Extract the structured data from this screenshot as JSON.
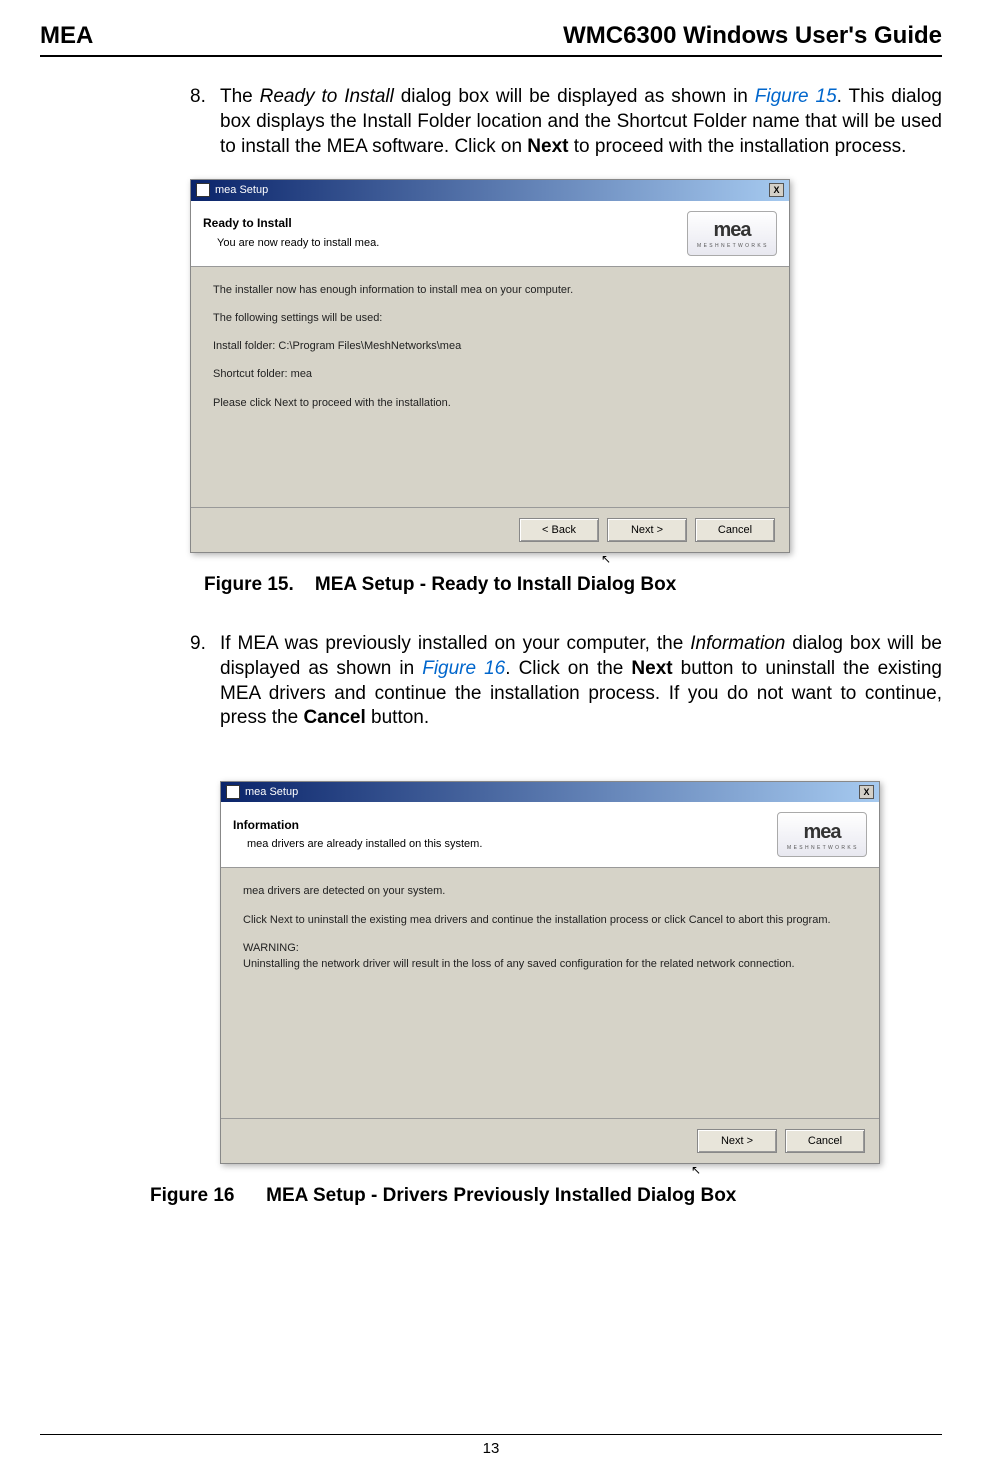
{
  "header": {
    "left": "MEA",
    "right": "WMC6300 Windows User's Guide"
  },
  "item8": {
    "num": "8.",
    "t1": "The ",
    "italic1": "Ready to Install",
    "t2": " dialog box will be displayed as shown in ",
    "figref": "Figure 15",
    "t3": ". This dialog box displays the Install Folder location and the Shortcut Folder name that will be used to install the MEA software.  Click on ",
    "bold1": "Next",
    "t4": " to proceed with the installation process."
  },
  "dialog1": {
    "title": "mea Setup",
    "close": "X",
    "headerTitle": "Ready to Install",
    "headerSub": "You are now ready to install mea.",
    "logo": "mea",
    "logoSub": "M E S H N E T W O R K S",
    "body1": "The installer now has enough information to install mea on your computer.",
    "body2": "The following settings will be used:",
    "body3": "Install folder: C:\\Program Files\\MeshNetworks\\mea",
    "body4": "Shortcut folder: mea",
    "body5": "Please click Next to proceed with the installation.",
    "btnBack": "< Back",
    "btnNext": "Next >",
    "btnCancel": "Cancel"
  },
  "caption1": {
    "num": "Figure 15.",
    "text": "MEA Setup - Ready to Install Dialog Box"
  },
  "item9": {
    "num": "9.",
    "t1": "If MEA was previously installed on your computer, the ",
    "italic1": "Information",
    "t2": " dialog box will be displayed as shown in ",
    "figref": "Figure 16",
    "t3": ".  Click on the ",
    "bold1": "Next",
    "t4": " button to uninstall the existing MEA drivers and continue the installation process.  If you do not want to continue, press the ",
    "bold2": "Cancel",
    "t5": " button."
  },
  "dialog2": {
    "title": "mea Setup",
    "close": "X",
    "headerTitle": "Information",
    "headerSub": "mea drivers are already installed on this system.",
    "logo": "mea",
    "logoSub": "M E S H N E T W O R K S",
    "body1": "mea drivers are detected on your system.",
    "body2": "Click Next to uninstall the existing mea drivers and continue the installation process or click Cancel to abort this program.",
    "body3": "WARNING:",
    "body4": "Uninstalling the network driver will result in the loss of any saved configuration for the related network connection.",
    "btnNext": "Next >",
    "btnCancel": "Cancel"
  },
  "caption2": {
    "num": "Figure 16",
    "text": "MEA Setup - Drivers Previously Installed Dialog Box"
  },
  "pageNum": "13"
}
